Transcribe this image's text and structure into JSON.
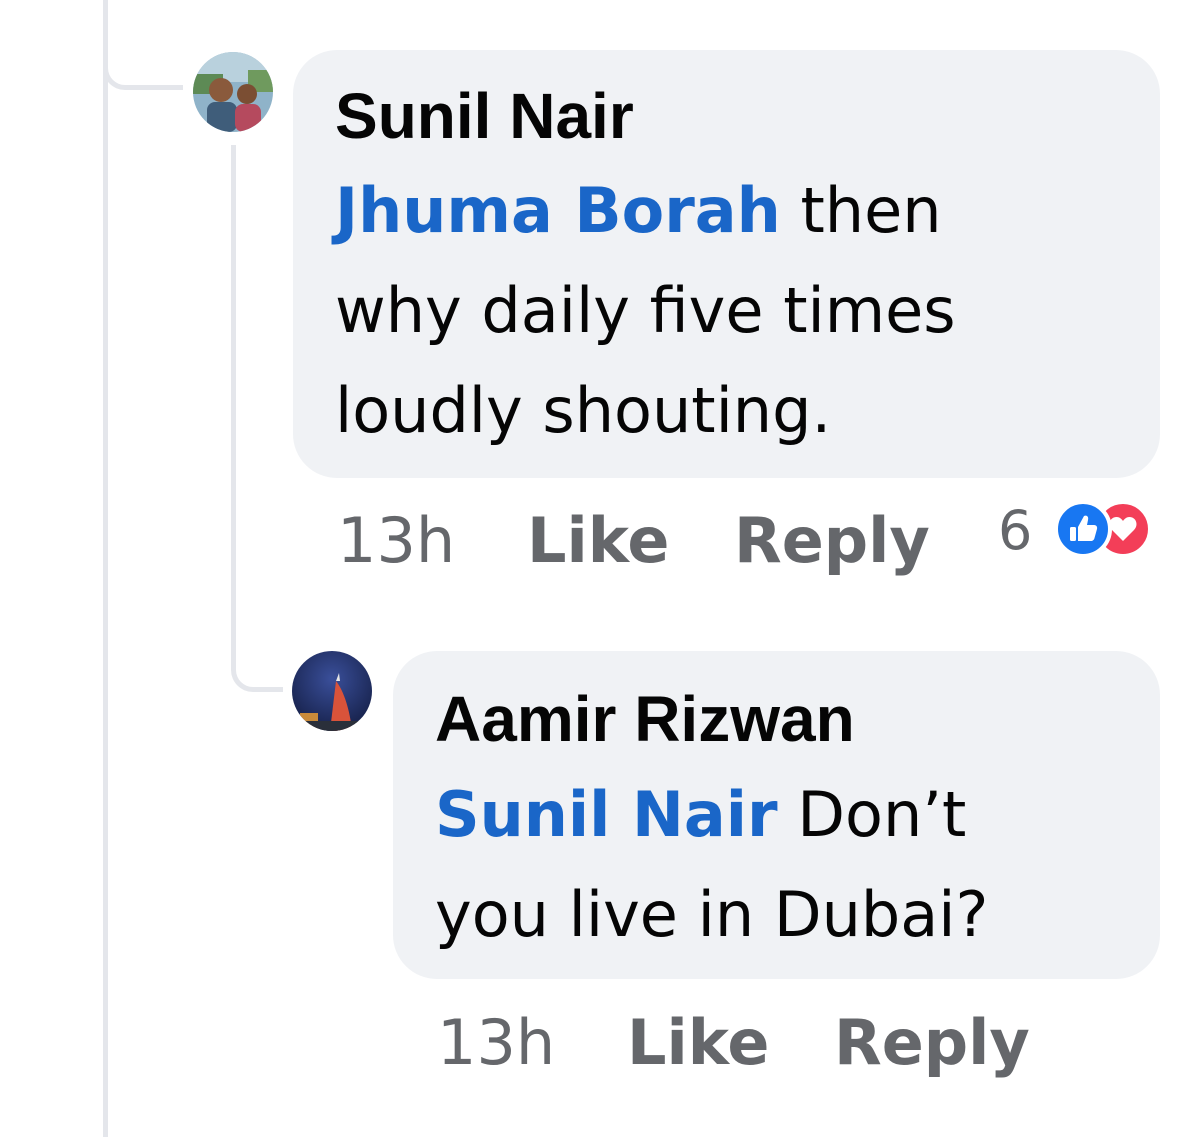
{
  "comments": [
    {
      "author": "Sunil Nair",
      "mention": "Jhuma Borah",
      "line1_rest": " then",
      "line2": "why daily five times",
      "line3": "loudly shouting.",
      "time": "13h",
      "like_label": "Like",
      "reply_label": "Reply",
      "reaction_count": "6",
      "reactions": [
        "like-icon",
        "love-icon"
      ]
    },
    {
      "author": "Aamir Rizwan",
      "mention": "Sunil Nair",
      "line1_rest": " Don’t",
      "line2": "you live in Dubai?",
      "time": "13h",
      "like_label": "Like",
      "reply_label": "Reply"
    }
  ],
  "colors": {
    "bubble": "#f0f2f5",
    "mention": "#1a66c8",
    "like_reaction": "#1877f2",
    "love_reaction": "#f33e58",
    "meta_text": "#65676b"
  }
}
